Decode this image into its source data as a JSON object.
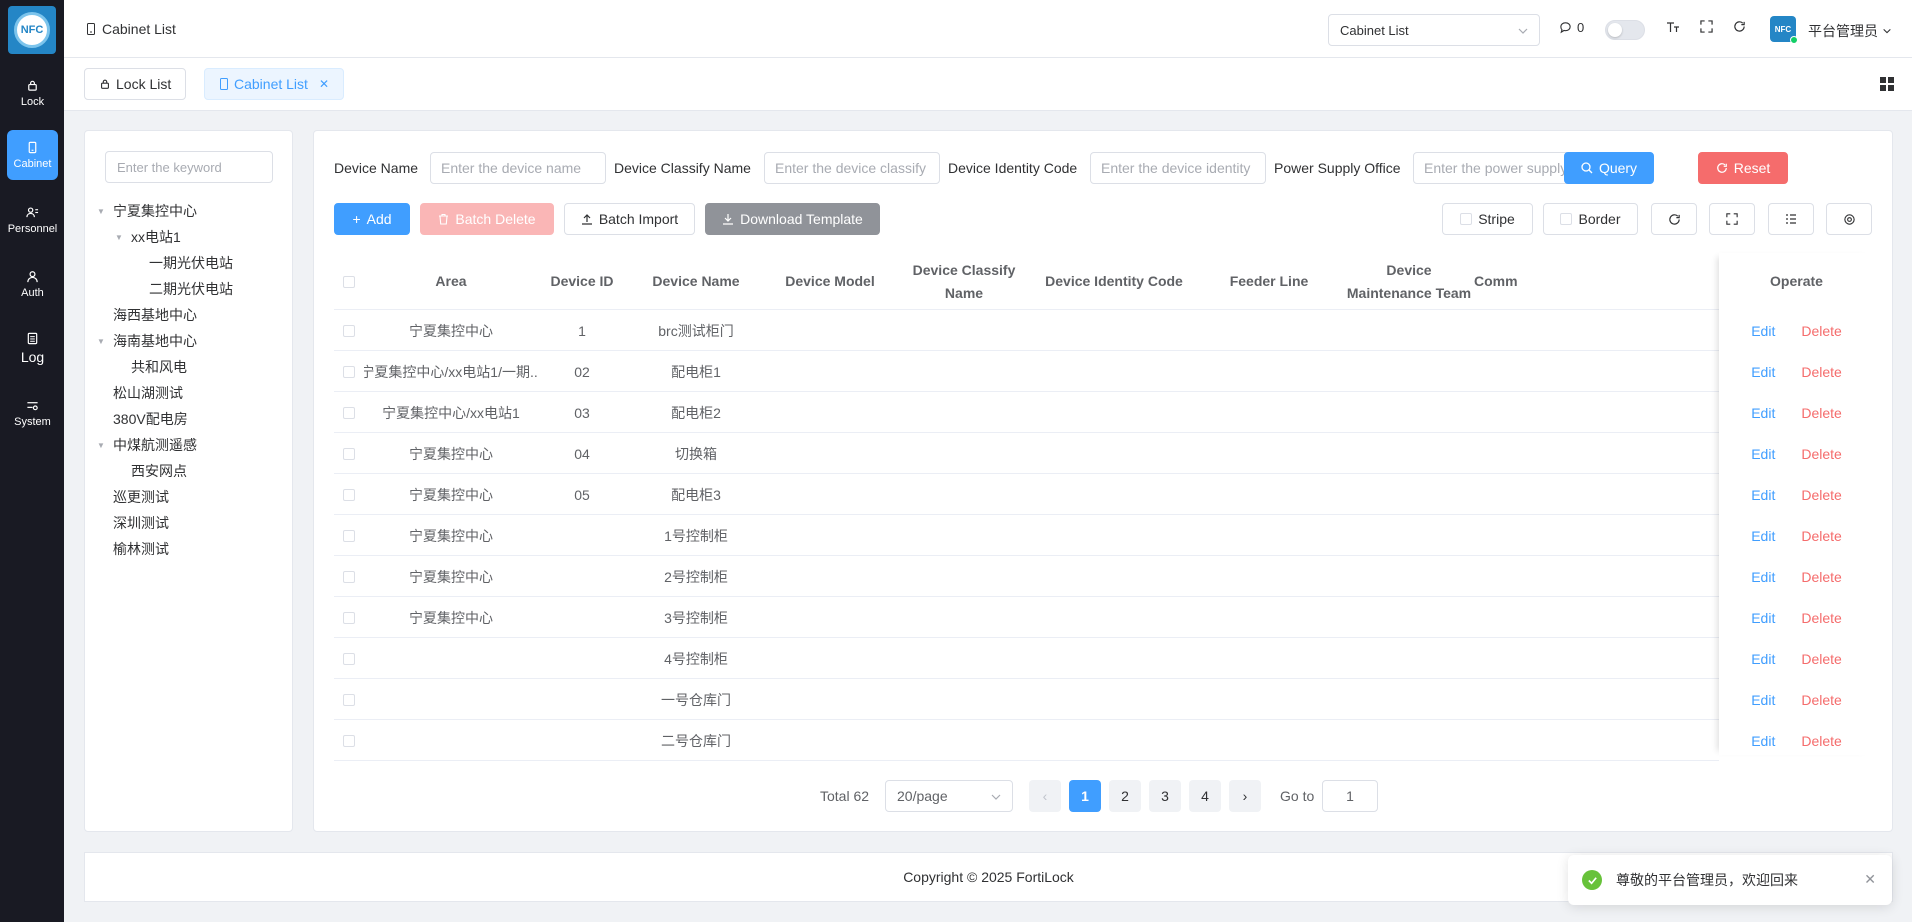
{
  "sidebar": {
    "logo_text": "NFC",
    "items": [
      {
        "label": "Lock",
        "icon": "lock-icon"
      },
      {
        "label": "Cabinet",
        "icon": "cabinet-icon",
        "active": true
      },
      {
        "label": "Personnel",
        "icon": "personnel-icon"
      },
      {
        "label": "Auth",
        "icon": "user-icon"
      },
      {
        "label": "Log",
        "icon": "log-icon"
      },
      {
        "label": "System",
        "icon": "system-icon"
      }
    ]
  },
  "header": {
    "breadcrumb": "Cabinet List",
    "page_select": "Cabinet List",
    "message_count": "0",
    "username": "平台管理员",
    "avatar_text": "NFC"
  },
  "tabs": [
    {
      "label": "Lock List"
    },
    {
      "label": "Cabinet List",
      "active": true
    }
  ],
  "tree": {
    "search_placeholder": "Enter the keyword",
    "nodes": [
      {
        "label": "宁夏集控中心",
        "level": 0,
        "expanded": true
      },
      {
        "label": "xx电站1",
        "level": 1,
        "expanded": true
      },
      {
        "label": "一期光伏电站",
        "level": 2
      },
      {
        "label": "二期光伏电站",
        "level": 2
      },
      {
        "label": "海西基地中心",
        "level": 0
      },
      {
        "label": "海南基地中心",
        "level": 0,
        "expanded": true
      },
      {
        "label": "共和风电",
        "level": 1
      },
      {
        "label": "松山湖测试",
        "level": 0
      },
      {
        "label": "380V配电房",
        "level": 0
      },
      {
        "label": "中煤航测遥感",
        "level": 0,
        "expanded": true
      },
      {
        "label": "西安网点",
        "level": 1
      },
      {
        "label": "巡更测试",
        "level": 0
      },
      {
        "label": "深圳测试",
        "level": 0
      },
      {
        "label": "榆林测试",
        "level": 0
      }
    ]
  },
  "filters": {
    "device_name_label": "Device Name",
    "device_name_placeholder": "Enter the device name",
    "classify_label": "Device Classify Name",
    "classify_placeholder": "Enter the device classify",
    "identity_label": "Device Identity Code",
    "identity_placeholder": "Enter the device identity",
    "office_label": "Power Supply Office",
    "office_placeholder": "Enter the power supply c",
    "query_label": "Query",
    "reset_label": "Reset"
  },
  "toolbar": {
    "add_label": "Add",
    "batch_delete_label": "Batch Delete",
    "batch_import_label": "Batch Import",
    "download_label": "Download Template",
    "stripe_label": "Stripe",
    "border_label": "Border"
  },
  "table": {
    "columns": [
      "Area",
      "Device ID",
      "Device Name",
      "Device Model",
      "Device Classify Name",
      "Device Identity Code",
      "Feeder Line",
      "Device Maintenance Team",
      "Comm",
      "Operate"
    ],
    "edit_label": "Edit",
    "delete_label": "Delete",
    "rows": [
      {
        "area": "宁夏集控中心",
        "id": "1",
        "name": "brc测试柜门"
      },
      {
        "area": "宁夏集控中心/xx电站1/一期...",
        "id": "02",
        "name": "配电柜1"
      },
      {
        "area": "宁夏集控中心/xx电站1",
        "id": "03",
        "name": "配电柜2"
      },
      {
        "area": "宁夏集控中心",
        "id": "04",
        "name": "切换箱"
      },
      {
        "area": "宁夏集控中心",
        "id": "05",
        "name": "配电柜3"
      },
      {
        "area": "宁夏集控中心",
        "id": "",
        "name": "1号控制柜"
      },
      {
        "area": "宁夏集控中心",
        "id": "",
        "name": "2号控制柜"
      },
      {
        "area": "宁夏集控中心",
        "id": "",
        "name": "3号控制柜"
      },
      {
        "area": "",
        "id": "",
        "name": "4号控制柜"
      },
      {
        "area": "",
        "id": "",
        "name": "一号仓库门"
      },
      {
        "area": "",
        "id": "",
        "name": "二号仓库门"
      }
    ]
  },
  "pagination": {
    "total_label": "Total 62",
    "page_size": "20/page",
    "pages": [
      "1",
      "2",
      "3",
      "4"
    ],
    "current_page": "1",
    "goto_label": "Go to",
    "goto_value": "1"
  },
  "footer": {
    "copyright": "Copyright © 2025 FortiLock"
  },
  "toast": {
    "message": "尊敬的平台管理员，欢迎回来"
  },
  "colors": {
    "sidebar_bg": "#191a23",
    "primary": "#409eff",
    "danger": "#f56c6c",
    "success": "#67c23a"
  }
}
